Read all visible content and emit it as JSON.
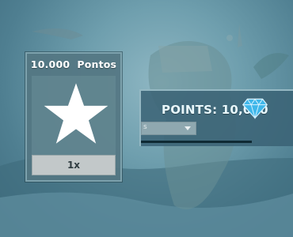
{
  "reward": {
    "title": "10.000  Pontos",
    "quantity_label": "1x",
    "icon": "star-icon"
  },
  "points": {
    "label": "POINTS: 10,000",
    "icon": "diamond-gem-icon",
    "dropdown_value": "s"
  },
  "colors": {
    "panel": "#547682",
    "star": "#ffffff",
    "gem": "#3fb7ea",
    "qty_bar": "#c2c8c9"
  }
}
